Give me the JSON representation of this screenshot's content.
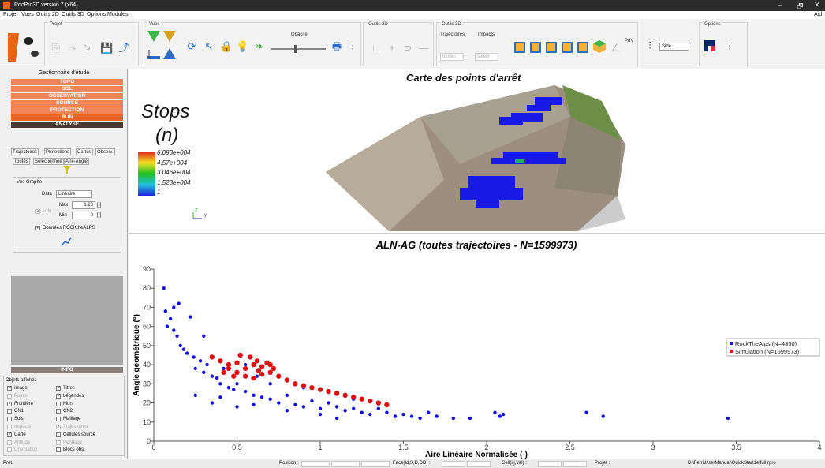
{
  "window": {
    "title": "RocPro3D version 7 (x64)",
    "minimize": "–",
    "maximize": "🗗",
    "close": "✕",
    "aide": "Aid"
  },
  "menu": [
    "Projet",
    "Vues",
    "Outils 2D",
    "Outils 3D",
    "Options",
    "Modules"
  ],
  "toolbar": {
    "projet": "Projet",
    "vues": "Vues",
    "opacite": "Opacité",
    "outils2d": "Outils 2D",
    "outils3d": "Outils 3D",
    "trajectoires": "Trajectoires",
    "impacts": "Impacts",
    "toutes": "toutes",
    "select": "select",
    "pdv": "PdV",
    "side": "Side",
    "options": "Options"
  },
  "left": {
    "manager": "Gestionnaire d'étude",
    "nav": [
      {
        "label": "TOPO",
        "color": "#f0855a"
      },
      {
        "label": "SOL",
        "color": "#f0855a"
      },
      {
        "label": "OBSERVATION",
        "color": "#f0855a"
      },
      {
        "label": "SOURCE",
        "color": "#f0855a"
      },
      {
        "label": "PROTECTION",
        "color": "#f0855a"
      },
      {
        "label": "RUN",
        "color": "#e8672e"
      },
      {
        "label": "ANALYSE",
        "color": "#4a3a36"
      }
    ],
    "tabs1": [
      "Trajectoires",
      "Protections",
      "Cartes",
      "Observ."
    ],
    "tabs2": [
      "Toutes",
      "Sélectionnée",
      "Aire-Angle"
    ],
    "vue_graphe": "Vue Graphe",
    "data_label": "Data",
    "data_value": "Linéaire",
    "auto": "Auto",
    "max_label": "Max",
    "max_value": "1.28",
    "min_label": "Min",
    "min_value": "0",
    "unit": "[-]",
    "donnees": "Données ROCKtheALPS",
    "info": "INFO",
    "objets": "Objets affichés",
    "objects": [
      {
        "label": "Image",
        "checked": true,
        "enabled": true
      },
      {
        "label": "Titres",
        "checked": true,
        "enabled": true
      },
      {
        "label": "Points",
        "checked": false,
        "enabled": false
      },
      {
        "label": "Légendes",
        "checked": true,
        "enabled": true
      },
      {
        "label": "Frontière",
        "checked": true,
        "enabled": true
      },
      {
        "label": "Murs",
        "checked": false,
        "enabled": true
      },
      {
        "label": "CN1",
        "checked": false,
        "enabled": true
      },
      {
        "label": "CN2",
        "checked": false,
        "enabled": true
      },
      {
        "label": "Sols",
        "checked": false,
        "enabled": true
      },
      {
        "label": "Maillage",
        "checked": false,
        "enabled": true
      },
      {
        "label": "Impacts",
        "checked": false,
        "enabled": false
      },
      {
        "label": "Trajectoires",
        "checked": true,
        "enabled": false
      },
      {
        "label": "Carte",
        "checked": true,
        "enabled": true
      },
      {
        "label": "Cellules source",
        "checked": false,
        "enabled": true
      },
      {
        "label": "Altitude",
        "checked": false,
        "enabled": false
      },
      {
        "label": "Pendage",
        "checked": false,
        "enabled": false
      },
      {
        "label": "Orientation",
        "checked": false,
        "enabled": false
      },
      {
        "label": "Blocs obs.",
        "checked": false,
        "enabled": true
      }
    ]
  },
  "map": {
    "title": "Carte des points d'arrêt",
    "legend_title1": "Stops",
    "legend_title2": "(n)",
    "legend_values": [
      "6.093e+004",
      "4.57e+004",
      "3.046e+004",
      "1.523e+004",
      "1"
    ],
    "axis_z": "z",
    "axis_y": "y"
  },
  "chart_data": {
    "type": "scatter",
    "title": "ALN-AG (toutes trajectoires - N=1599973)",
    "xlabel": "Aire Linéaire Normalisée (-)",
    "ylabel": "Angle géométrique (°)",
    "xlim": [
      0,
      4
    ],
    "ylim": [
      0,
      90
    ],
    "xticks": [
      "0",
      "0.5",
      "1",
      "1.5",
      "2",
      "2.5",
      "3",
      "3.5",
      "4"
    ],
    "yticks": [
      "0",
      "10",
      "20",
      "30",
      "40",
      "50",
      "60",
      "70",
      "80",
      "90"
    ],
    "grid": false,
    "legend_position": "right",
    "series": [
      {
        "name": "RockTheAlps (N=4350)",
        "color": "#1010e0",
        "points": [
          [
            0.06,
            80
          ],
          [
            0.07,
            68
          ],
          [
            0.08,
            60
          ],
          [
            0.1,
            64
          ],
          [
            0.12,
            58
          ],
          [
            0.14,
            55
          ],
          [
            0.15,
            72
          ],
          [
            0.16,
            50
          ],
          [
            0.18,
            48
          ],
          [
            0.2,
            46
          ],
          [
            0.22,
            65
          ],
          [
            0.24,
            44
          ],
          [
            0.25,
            38
          ],
          [
            0.28,
            42
          ],
          [
            0.3,
            36
          ],
          [
            0.32,
            40
          ],
          [
            0.35,
            34
          ],
          [
            0.38,
            33
          ],
          [
            0.4,
            30
          ],
          [
            0.42,
            38
          ],
          [
            0.45,
            28
          ],
          [
            0.48,
            27
          ],
          [
            0.5,
            30
          ],
          [
            0.55,
            26
          ],
          [
            0.6,
            24
          ],
          [
            0.62,
            34
          ],
          [
            0.65,
            23
          ],
          [
            0.7,
            22
          ],
          [
            0.75,
            20
          ],
          [
            0.8,
            24
          ],
          [
            0.85,
            19
          ],
          [
            0.9,
            18
          ],
          [
            0.95,
            21
          ],
          [
            1.0,
            17
          ],
          [
            1.05,
            20
          ],
          [
            1.1,
            18
          ],
          [
            1.15,
            16
          ],
          [
            1.2,
            17
          ],
          [
            1.25,
            15
          ],
          [
            1.3,
            14
          ],
          [
            1.35,
            17
          ],
          [
            1.4,
            15
          ],
          [
            1.45,
            13
          ],
          [
            1.5,
            14
          ],
          [
            1.55,
            13
          ],
          [
            1.6,
            12
          ],
          [
            1.65,
            15
          ],
          [
            1.7,
            13
          ],
          [
            1.8,
            12
          ],
          [
            1.9,
            12
          ],
          [
            2.05,
            15
          ],
          [
            2.08,
            13
          ],
          [
            2.1,
            14
          ],
          [
            2.6,
            15
          ],
          [
            2.7,
            13
          ],
          [
            3.45,
            12
          ],
          [
            0.25,
            24
          ],
          [
            0.4,
            23
          ],
          [
            0.12,
            70
          ],
          [
            0.3,
            55
          ],
          [
            0.55,
            40
          ],
          [
            0.7,
            30
          ],
          [
            0.9,
            28
          ],
          [
            1.2,
            22
          ],
          [
            0.35,
            20
          ],
          [
            0.5,
            18
          ],
          [
            0.6,
            19
          ],
          [
            0.8,
            16
          ],
          [
            1.0,
            14
          ],
          [
            1.1,
            12
          ]
        ]
      },
      {
        "name": "Simulation (N=1599973)",
        "color": "#e01010",
        "points": [
          [
            0.35,
            44
          ],
          [
            0.4,
            42
          ],
          [
            0.45,
            40
          ],
          [
            0.5,
            41
          ],
          [
            0.55,
            38
          ],
          [
            0.6,
            40
          ],
          [
            0.62,
            42
          ],
          [
            0.65,
            39
          ],
          [
            0.7,
            36
          ],
          [
            0.75,
            34
          ],
          [
            0.8,
            32
          ],
          [
            0.85,
            30
          ],
          [
            0.9,
            29
          ],
          [
            0.95,
            28
          ],
          [
            1.0,
            27
          ],
          [
            1.05,
            26
          ],
          [
            1.1,
            25
          ],
          [
            1.15,
            24
          ],
          [
            1.2,
            23
          ],
          [
            1.25,
            22
          ],
          [
            1.3,
            21
          ],
          [
            1.35,
            20
          ],
          [
            1.4,
            19
          ],
          [
            0.42,
            36
          ],
          [
            0.48,
            34
          ],
          [
            0.52,
            45
          ],
          [
            0.58,
            44
          ],
          [
            0.63,
            37
          ],
          [
            0.68,
            41
          ],
          [
            0.72,
            38
          ],
          [
            0.5,
            36
          ],
          [
            0.55,
            34
          ],
          [
            0.6,
            33
          ],
          [
            0.45,
            38
          ],
          [
            0.65,
            35
          ],
          [
            0.7,
            40
          ]
        ]
      }
    ]
  },
  "status": {
    "ready": "Prêt.",
    "position": "Position :",
    "face": "Face(Id,S,D,DD) :",
    "cell": "Cell(i,j,Val) :",
    "projet": "Projet :",
    "path": "D:\\Ferri\\UserManual\\QuickStart1elfull.rpro"
  }
}
